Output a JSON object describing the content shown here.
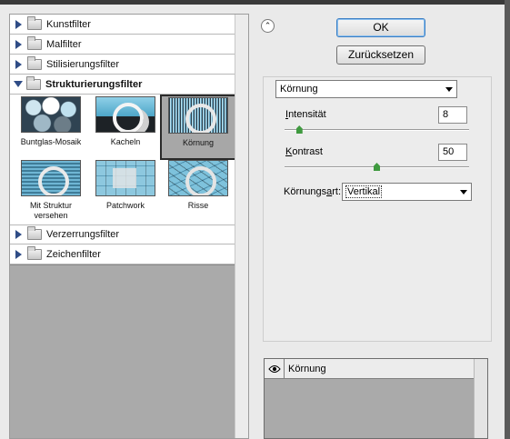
{
  "gallery": {
    "categories": [
      {
        "label": "Kunstfilter",
        "expanded": false
      },
      {
        "label": "Malfilter",
        "expanded": false
      },
      {
        "label": "Stilisierungsfilter",
        "expanded": false
      },
      {
        "label": "Strukturierungsfilter",
        "expanded": true
      },
      {
        "label": "Verzerrungsfilter",
        "expanded": false
      },
      {
        "label": "Zeichenfilter",
        "expanded": false
      }
    ],
    "thumbnails": [
      {
        "label": "Buntglas-Mosaik",
        "selected": false
      },
      {
        "label": "Kacheln",
        "selected": false
      },
      {
        "label": "Körnung",
        "selected": true
      },
      {
        "label": "Mit Struktur versehen",
        "selected": false
      },
      {
        "label": "Patchwork",
        "selected": false
      },
      {
        "label": "Risse",
        "selected": false
      }
    ]
  },
  "buttons": {
    "ok": "OK",
    "reset": "Zurücksetzen"
  },
  "settings": {
    "filter_select": "Körnung",
    "intensity": {
      "label_u": "I",
      "label_rest": "ntensität",
      "value": "8",
      "level": 8,
      "max": 100
    },
    "contrast": {
      "label_u": "K",
      "label_rest": "ontrast",
      "value": "50",
      "level": 50,
      "max": 100
    },
    "grain_type": {
      "label_pre": "Körnungs",
      "label_u": "a",
      "label_rest": "rt:",
      "value": "Vertikal"
    }
  },
  "layers": {
    "items": [
      {
        "label": "Körnung"
      }
    ]
  },
  "colors": {
    "accent_triangle": "#2f4c86",
    "slider_thumb": "#3f9a3f",
    "ok_focus": "#3b7fc4"
  }
}
